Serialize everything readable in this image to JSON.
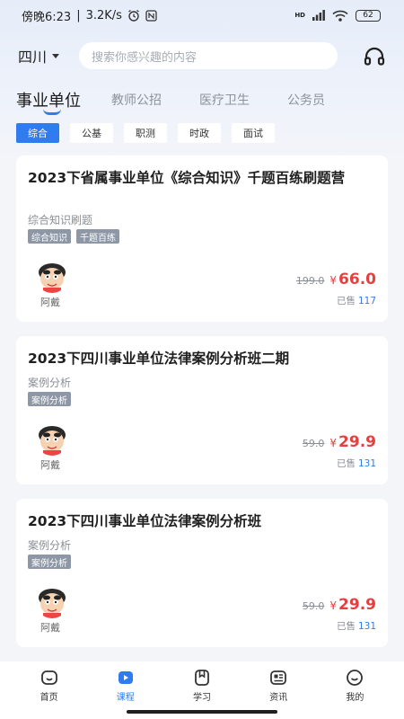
{
  "status_bar": {
    "time": "傍晚6:23",
    "speed": "3.2K/s",
    "signal": "HD",
    "battery": "62"
  },
  "header": {
    "region": "四川",
    "search_placeholder": "搜索你感兴趣的内容",
    "support_icon": "headset-icon"
  },
  "tabs": [
    {
      "label": "事业单位",
      "active": true
    },
    {
      "label": "教师公招"
    },
    {
      "label": "医疗卫生"
    },
    {
      "label": "公务员"
    }
  ],
  "chips": [
    {
      "label": "综合",
      "active": true
    },
    {
      "label": "公基"
    },
    {
      "label": "职测"
    },
    {
      "label": "时政"
    },
    {
      "label": "面试"
    }
  ],
  "courses": [
    {
      "title": "2023下省属事业单位《综合知识》千题百练刷题营",
      "subtitle": "综合知识刷题",
      "tags": [
        "综合知识",
        "千题百练"
      ],
      "teacher": "阿戴",
      "old_price": "199.0",
      "currency": "¥",
      "price": "66.0",
      "sold_label": "已售",
      "sold": "117"
    },
    {
      "title": "2023下四川事业单位法律案例分析班二期",
      "subtitle": "案例分析",
      "tags": [
        "案例分析"
      ],
      "teacher": "阿戴",
      "old_price": "59.0",
      "currency": "¥",
      "price": "29.9",
      "sold_label": "已售",
      "sold": "131"
    },
    {
      "title": "2023下四川事业单位法律案例分析班",
      "subtitle": "案例分析",
      "tags": [
        "案例分析"
      ],
      "teacher": "阿戴",
      "old_price": "59.0",
      "currency": "¥",
      "price": "29.9",
      "sold_label": "已售",
      "sold": "131"
    }
  ],
  "bottom_nav": [
    {
      "label": "首页",
      "icon": "home-icon"
    },
    {
      "label": "课程",
      "icon": "play-icon",
      "active": true
    },
    {
      "label": "学习",
      "icon": "bookmark-icon"
    },
    {
      "label": "资讯",
      "icon": "news-icon"
    },
    {
      "label": "我的",
      "icon": "profile-icon"
    }
  ],
  "colors": {
    "accent": "#2f7bf0",
    "price": "#e2413f",
    "tag": "#8d97a6"
  }
}
